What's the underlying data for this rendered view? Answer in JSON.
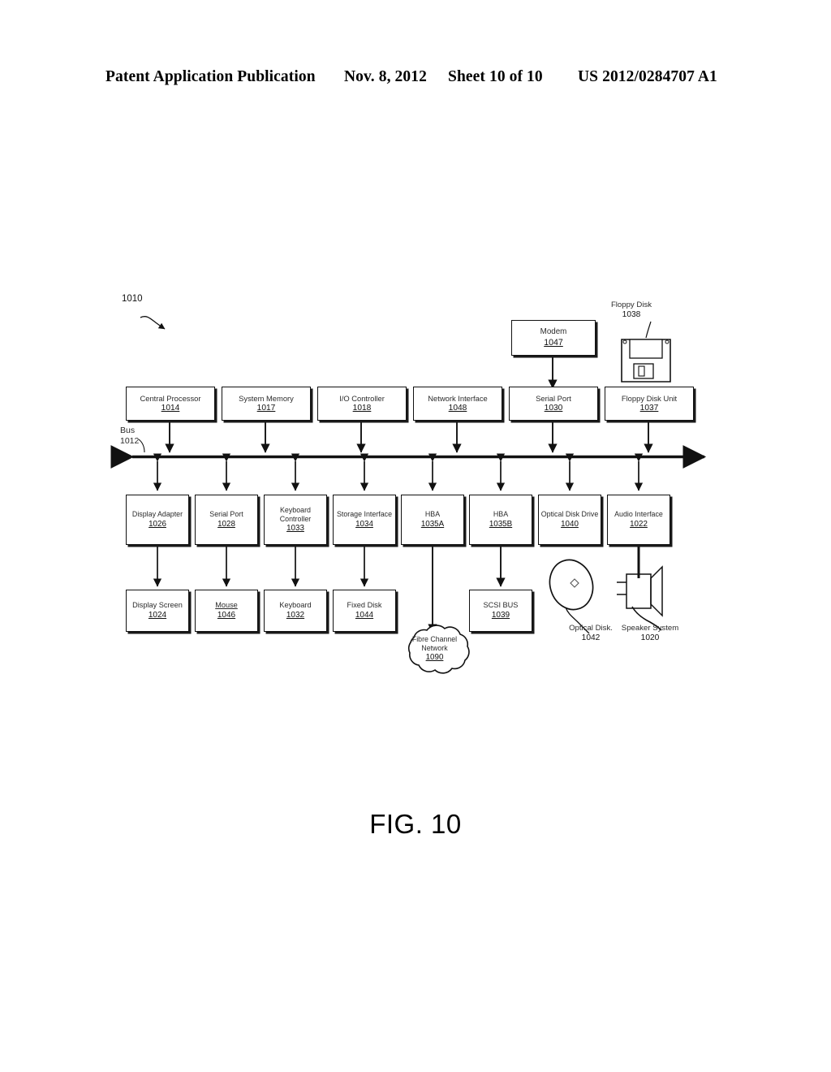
{
  "header": {
    "publication": "Patent Application Publication",
    "date": "Nov. 8, 2012",
    "sheet": "Sheet 10 of 10",
    "document_number": "US 2012/0284707 A1"
  },
  "figure": {
    "caption": "FIG. 10",
    "system_ref": "1010",
    "bus": {
      "label": "Bus",
      "ref": "1012"
    }
  },
  "top_row": [
    {
      "label": "Central Processor",
      "ref": "1014"
    },
    {
      "label": "System Memory",
      "ref": "1017"
    },
    {
      "label": "I/O Controller",
      "ref": "1018"
    },
    {
      "label": "Network Interface",
      "ref": "1048"
    },
    {
      "label": "Serial Port",
      "ref": "1030"
    },
    {
      "label": "Floppy Disk Unit",
      "ref": "1037"
    }
  ],
  "mid_row": [
    {
      "label": "Display Adapter",
      "ref": "1026"
    },
    {
      "label": "Serial Port",
      "ref": "1028"
    },
    {
      "label": "Keyboard Controller",
      "ref": "1033"
    },
    {
      "label": "Storage Interface",
      "ref": "1034"
    },
    {
      "label": "HBA",
      "ref": "1035A"
    },
    {
      "label": "HBA",
      "ref": "1035B"
    },
    {
      "label": "Optical Disk Drive",
      "ref": "1040"
    },
    {
      "label": "Audio Interface",
      "ref": "1022"
    }
  ],
  "bottom_row": [
    {
      "label": "Display Screen",
      "ref": "1024",
      "underline": false
    },
    {
      "label": "Mouse",
      "ref": "1046",
      "underline": true
    },
    {
      "label": "Keyboard",
      "ref": "1032",
      "underline": false
    },
    {
      "label": "Fixed Disk",
      "ref": "1044",
      "underline": false
    }
  ],
  "modem": {
    "label": "Modem",
    "ref": "1047"
  },
  "floppy_disk": {
    "label": "Floppy Disk",
    "ref": "1038"
  },
  "scsi_bus": {
    "label": "SCSI BUS",
    "ref": "1039"
  },
  "fibre_cloud": {
    "line1": "Fibre Channel",
    "line2": "Network",
    "ref": "1090"
  },
  "optical_disk": {
    "label": "Optical Disk.",
    "ref": "1042"
  },
  "speaker": {
    "label": "Speaker System",
    "ref": "1020"
  },
  "colors": {
    "ink": "#111111",
    "text": "#2b2b2b",
    "paper": "#ffffff"
  }
}
